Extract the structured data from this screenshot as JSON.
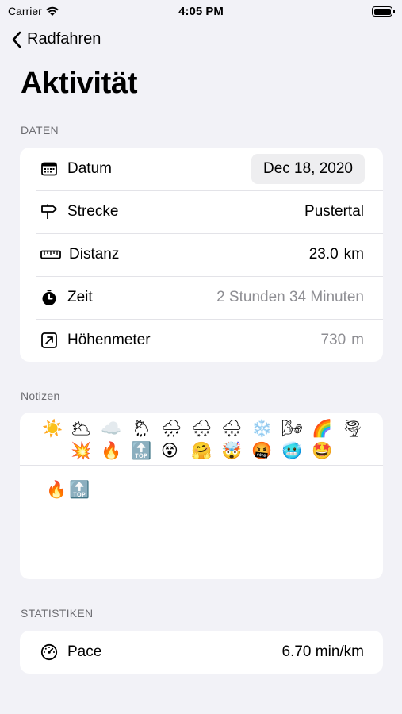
{
  "status_bar": {
    "carrier": "Carrier",
    "time": "4:05 PM"
  },
  "nav": {
    "back_label": "Radfahren",
    "title": "Aktivität"
  },
  "sections": {
    "data": "DATEN",
    "notes": "Notizen",
    "stats": "STATISTIKEN"
  },
  "rows": [
    {
      "icon": "calendar-icon",
      "label": "Datum",
      "value": "Dec 18, 2020"
    },
    {
      "icon": "signpost-icon",
      "label": "Strecke",
      "value": "Pustertal"
    },
    {
      "icon": "ruler-icon",
      "label": "Distanz",
      "value": "23.0",
      "unit": "km"
    },
    {
      "icon": "stopwatch-icon",
      "label": "Zeit",
      "value": "2 Stunden 34 Minuten"
    },
    {
      "icon": "elevation-icon",
      "label": "Höhenmeter",
      "value": "730",
      "unit": "m"
    }
  ],
  "emoji_bar": {
    "row1": [
      "☀️",
      "🌥",
      "☁️",
      "🌦",
      "🌧",
      "🌨",
      "🌨",
      "❄️",
      "🌬",
      "🌈",
      "🌪"
    ],
    "row2": [
      "💥",
      "🔥",
      "🔝",
      "😵",
      "🤗",
      "🤯",
      "🤬",
      "🥶",
      "🤩"
    ]
  },
  "notes_content": [
    "🔥",
    "🔝"
  ],
  "stats": [
    {
      "icon": "gauge-icon",
      "label": "Pace",
      "value": "6.70 min/km"
    }
  ]
}
